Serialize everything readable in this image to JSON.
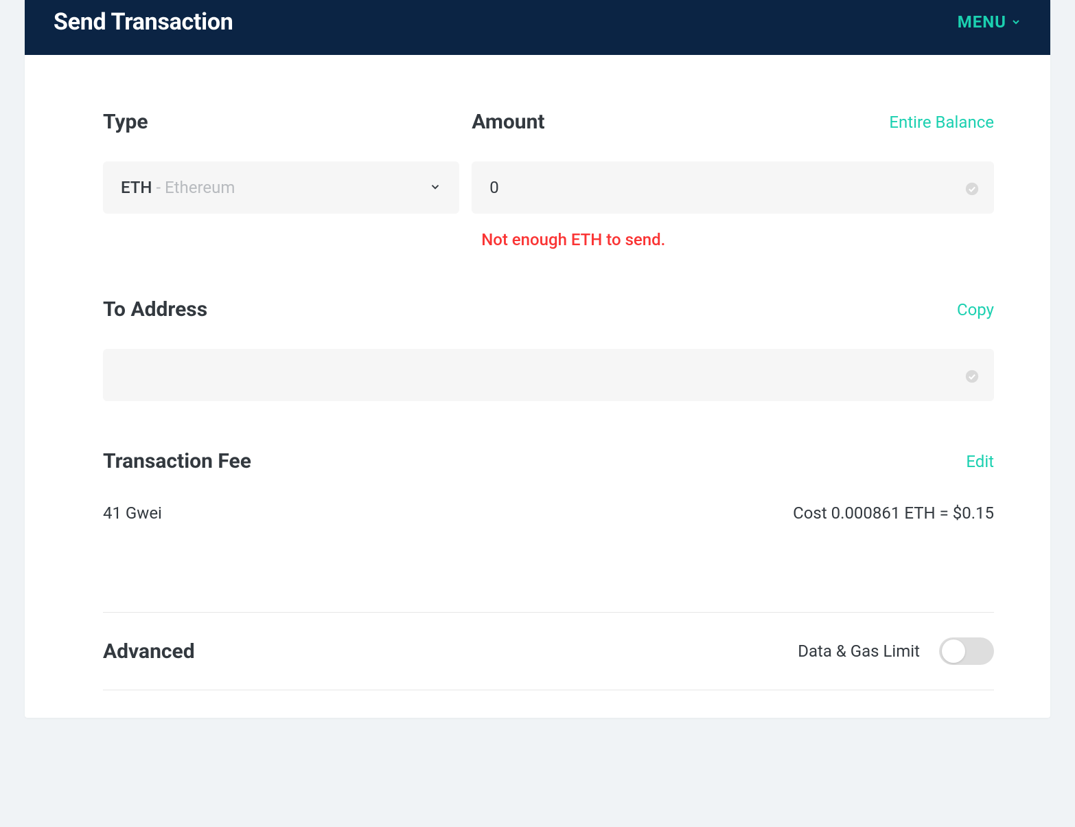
{
  "header": {
    "title": "Send Transaction",
    "menu_label": "MENU"
  },
  "type": {
    "label": "Type",
    "symbol": "ETH",
    "name": "- Ethereum"
  },
  "amount": {
    "label": "Amount",
    "entire_balance_label": "Entire Balance",
    "value": "0",
    "error": "Not enough ETH to send."
  },
  "to_address": {
    "label": "To Address",
    "copy_label": "Copy",
    "value": ""
  },
  "fee": {
    "label": "Transaction Fee",
    "edit_label": "Edit",
    "gwei": "41 Gwei",
    "cost": "Cost 0.000861 ETH = $0.15"
  },
  "advanced": {
    "label": "Advanced",
    "toggle_label": "Data & Gas Limit"
  }
}
